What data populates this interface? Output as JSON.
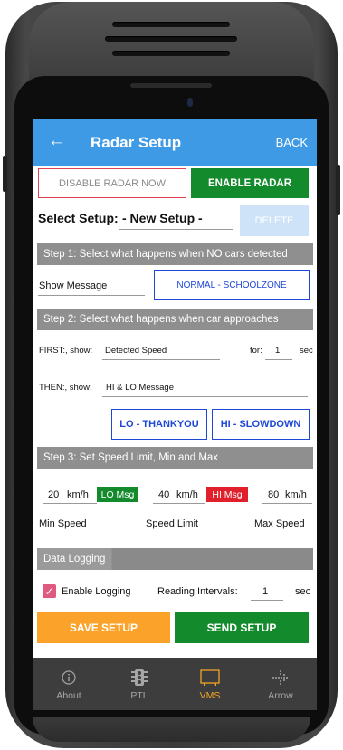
{
  "appbar": {
    "title": "Radar Setup",
    "back_label": "BACK"
  },
  "radar_buttons": {
    "disable": "DISABLE RADAR NOW",
    "enable": "ENABLE RADAR"
  },
  "setup": {
    "label": "Select Setup:",
    "value": "- New Setup -",
    "delete": "DELETE"
  },
  "step1": {
    "title": "Step 1: Select what happens when NO cars detected",
    "action": "Show Message",
    "message_button": "NORMAL - SCHOOLZONE"
  },
  "step2": {
    "title": "Step 2: Select what happens when car approaches",
    "first_label": "FIRST:, show:",
    "first_value": "Detected Speed",
    "for_label": "for:",
    "for_value": "1",
    "for_unit": "sec",
    "then_label": "THEN:, show:",
    "then_value": "HI & LO Message",
    "lo_button": "LO - THANKYOU",
    "hi_button": "HI - SLOWDOWN"
  },
  "step3": {
    "title": "Step 3: Set Speed Limit, Min and Max",
    "min_value": "20",
    "limit_value": "40",
    "max_value": "80",
    "unit": "km/h",
    "lo_badge": "LO Msg",
    "hi_badge": "HI Msg",
    "min_label": "Min Speed",
    "limit_label": "Speed Limit",
    "max_label": "Max Speed"
  },
  "logging": {
    "title": "Data Logging",
    "enable_label": "Enable Logging",
    "enabled": true,
    "interval_label": "Reading Intervals:",
    "interval_value": "1",
    "interval_unit": "sec"
  },
  "actions": {
    "save": "SAVE SETUP",
    "send": "SEND SETUP"
  },
  "nav": {
    "items": [
      {
        "label": "About",
        "icon": "info-icon"
      },
      {
        "label": "PTL",
        "icon": "traffic-light-icon"
      },
      {
        "label": "VMS",
        "icon": "sign-board-icon",
        "active": true
      },
      {
        "label": "Arrow",
        "icon": "arrow-board-icon"
      }
    ]
  },
  "colors": {
    "appbar": "#3f9ae6",
    "enable_green": "#138a2c",
    "save_orange": "#fba22a",
    "section_gray": "#8f8f8f",
    "outline_blue": "#1f47d6",
    "disable_red": "#e0424f",
    "hi_red": "#e0202a",
    "nav_active": "#f1a524"
  }
}
